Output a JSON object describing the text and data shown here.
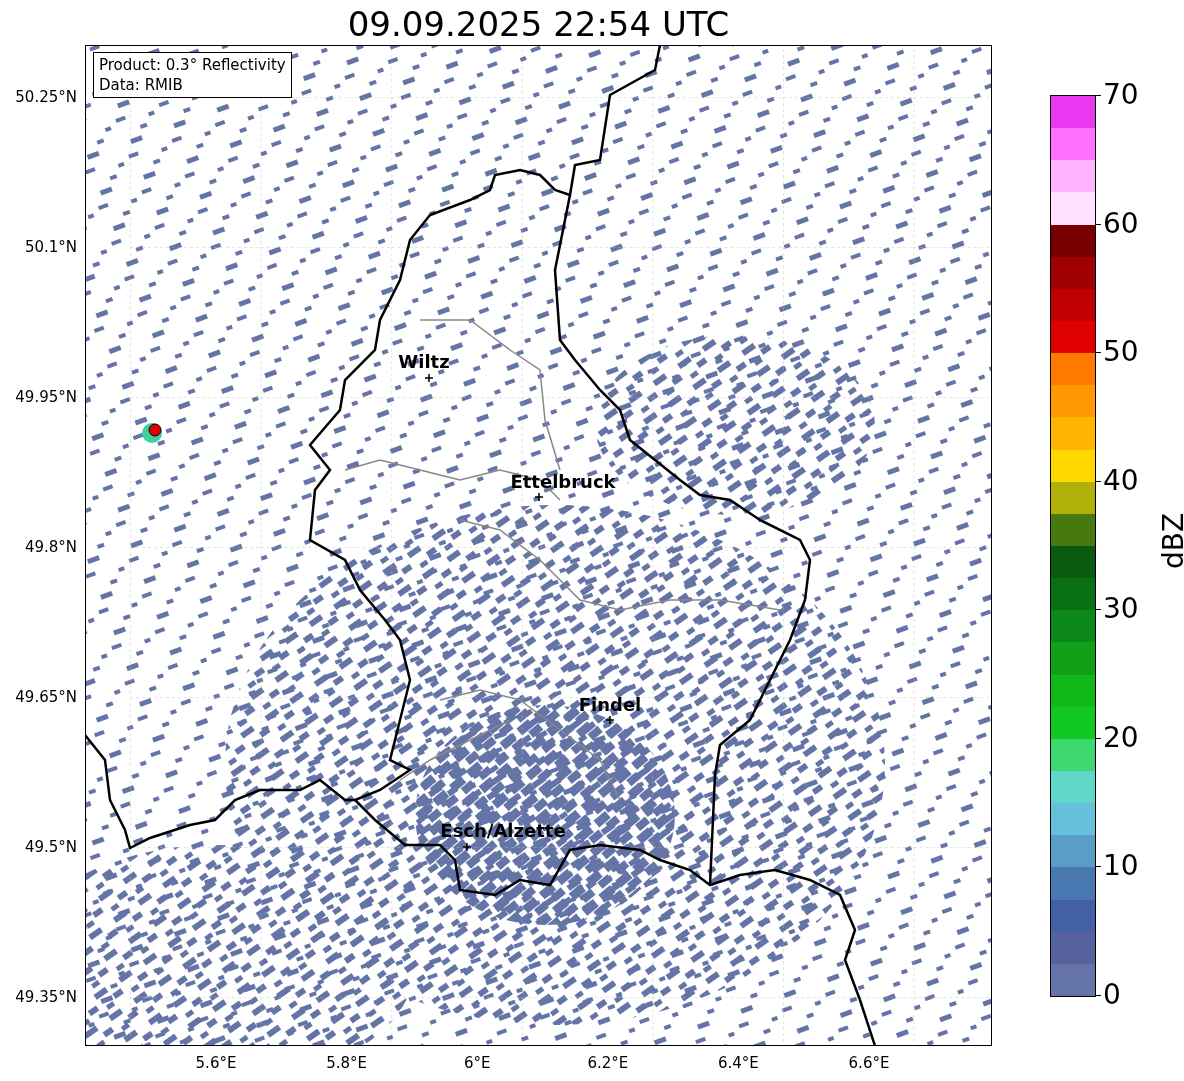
{
  "title": "09.09.2025 22:54 UTC",
  "legend_lines": [
    "Product: 0.3° Reflectivity",
    "Data: RMIB"
  ],
  "map": {
    "y_ticks": [
      "50.25°N",
      "50.1°N",
      "49.95°N",
      "49.8°N",
      "49.65°N",
      "49.5°N",
      "49.35°N"
    ],
    "x_ticks": [
      "5.6°E",
      "5.8°E",
      "6°E",
      "6.2°E",
      "6.4°E",
      "6.6°E"
    ],
    "cities": [
      "Wiltz",
      "Ettelbruck",
      "Findel",
      "Esch/Alzette"
    ]
  },
  "colorbar": {
    "label": "dBZ",
    "ticks": [
      "70",
      "60",
      "50",
      "40",
      "30",
      "20",
      "10",
      "0"
    ],
    "bands": [
      {
        "color": "#e838f0"
      },
      {
        "color": "#ff70ff"
      },
      {
        "color": "#ffb4ff"
      },
      {
        "color": "#ffe0ff"
      },
      {
        "color": "#780000"
      },
      {
        "color": "#a00000"
      },
      {
        "color": "#c00000"
      },
      {
        "color": "#e00000"
      },
      {
        "color": "#ff7800"
      },
      {
        "color": "#ff9800"
      },
      {
        "color": "#ffb400"
      },
      {
        "color": "#ffd800"
      },
      {
        "color": "#b0b008"
      },
      {
        "color": "#487810"
      },
      {
        "color": "#085a10"
      },
      {
        "color": "#0a7014"
      },
      {
        "color": "#0c8818"
      },
      {
        "color": "#10a018"
      },
      {
        "color": "#10b818"
      },
      {
        "color": "#10c820"
      },
      {
        "color": "#3ed870"
      },
      {
        "color": "#60d8c8"
      },
      {
        "color": "#66c0dc"
      },
      {
        "color": "#5a9ec8"
      },
      {
        "color": "#4a78b0"
      },
      {
        "color": "#4460a4"
      },
      {
        "color": "#55629e"
      },
      {
        "color": "#6574a8"
      }
    ]
  }
}
